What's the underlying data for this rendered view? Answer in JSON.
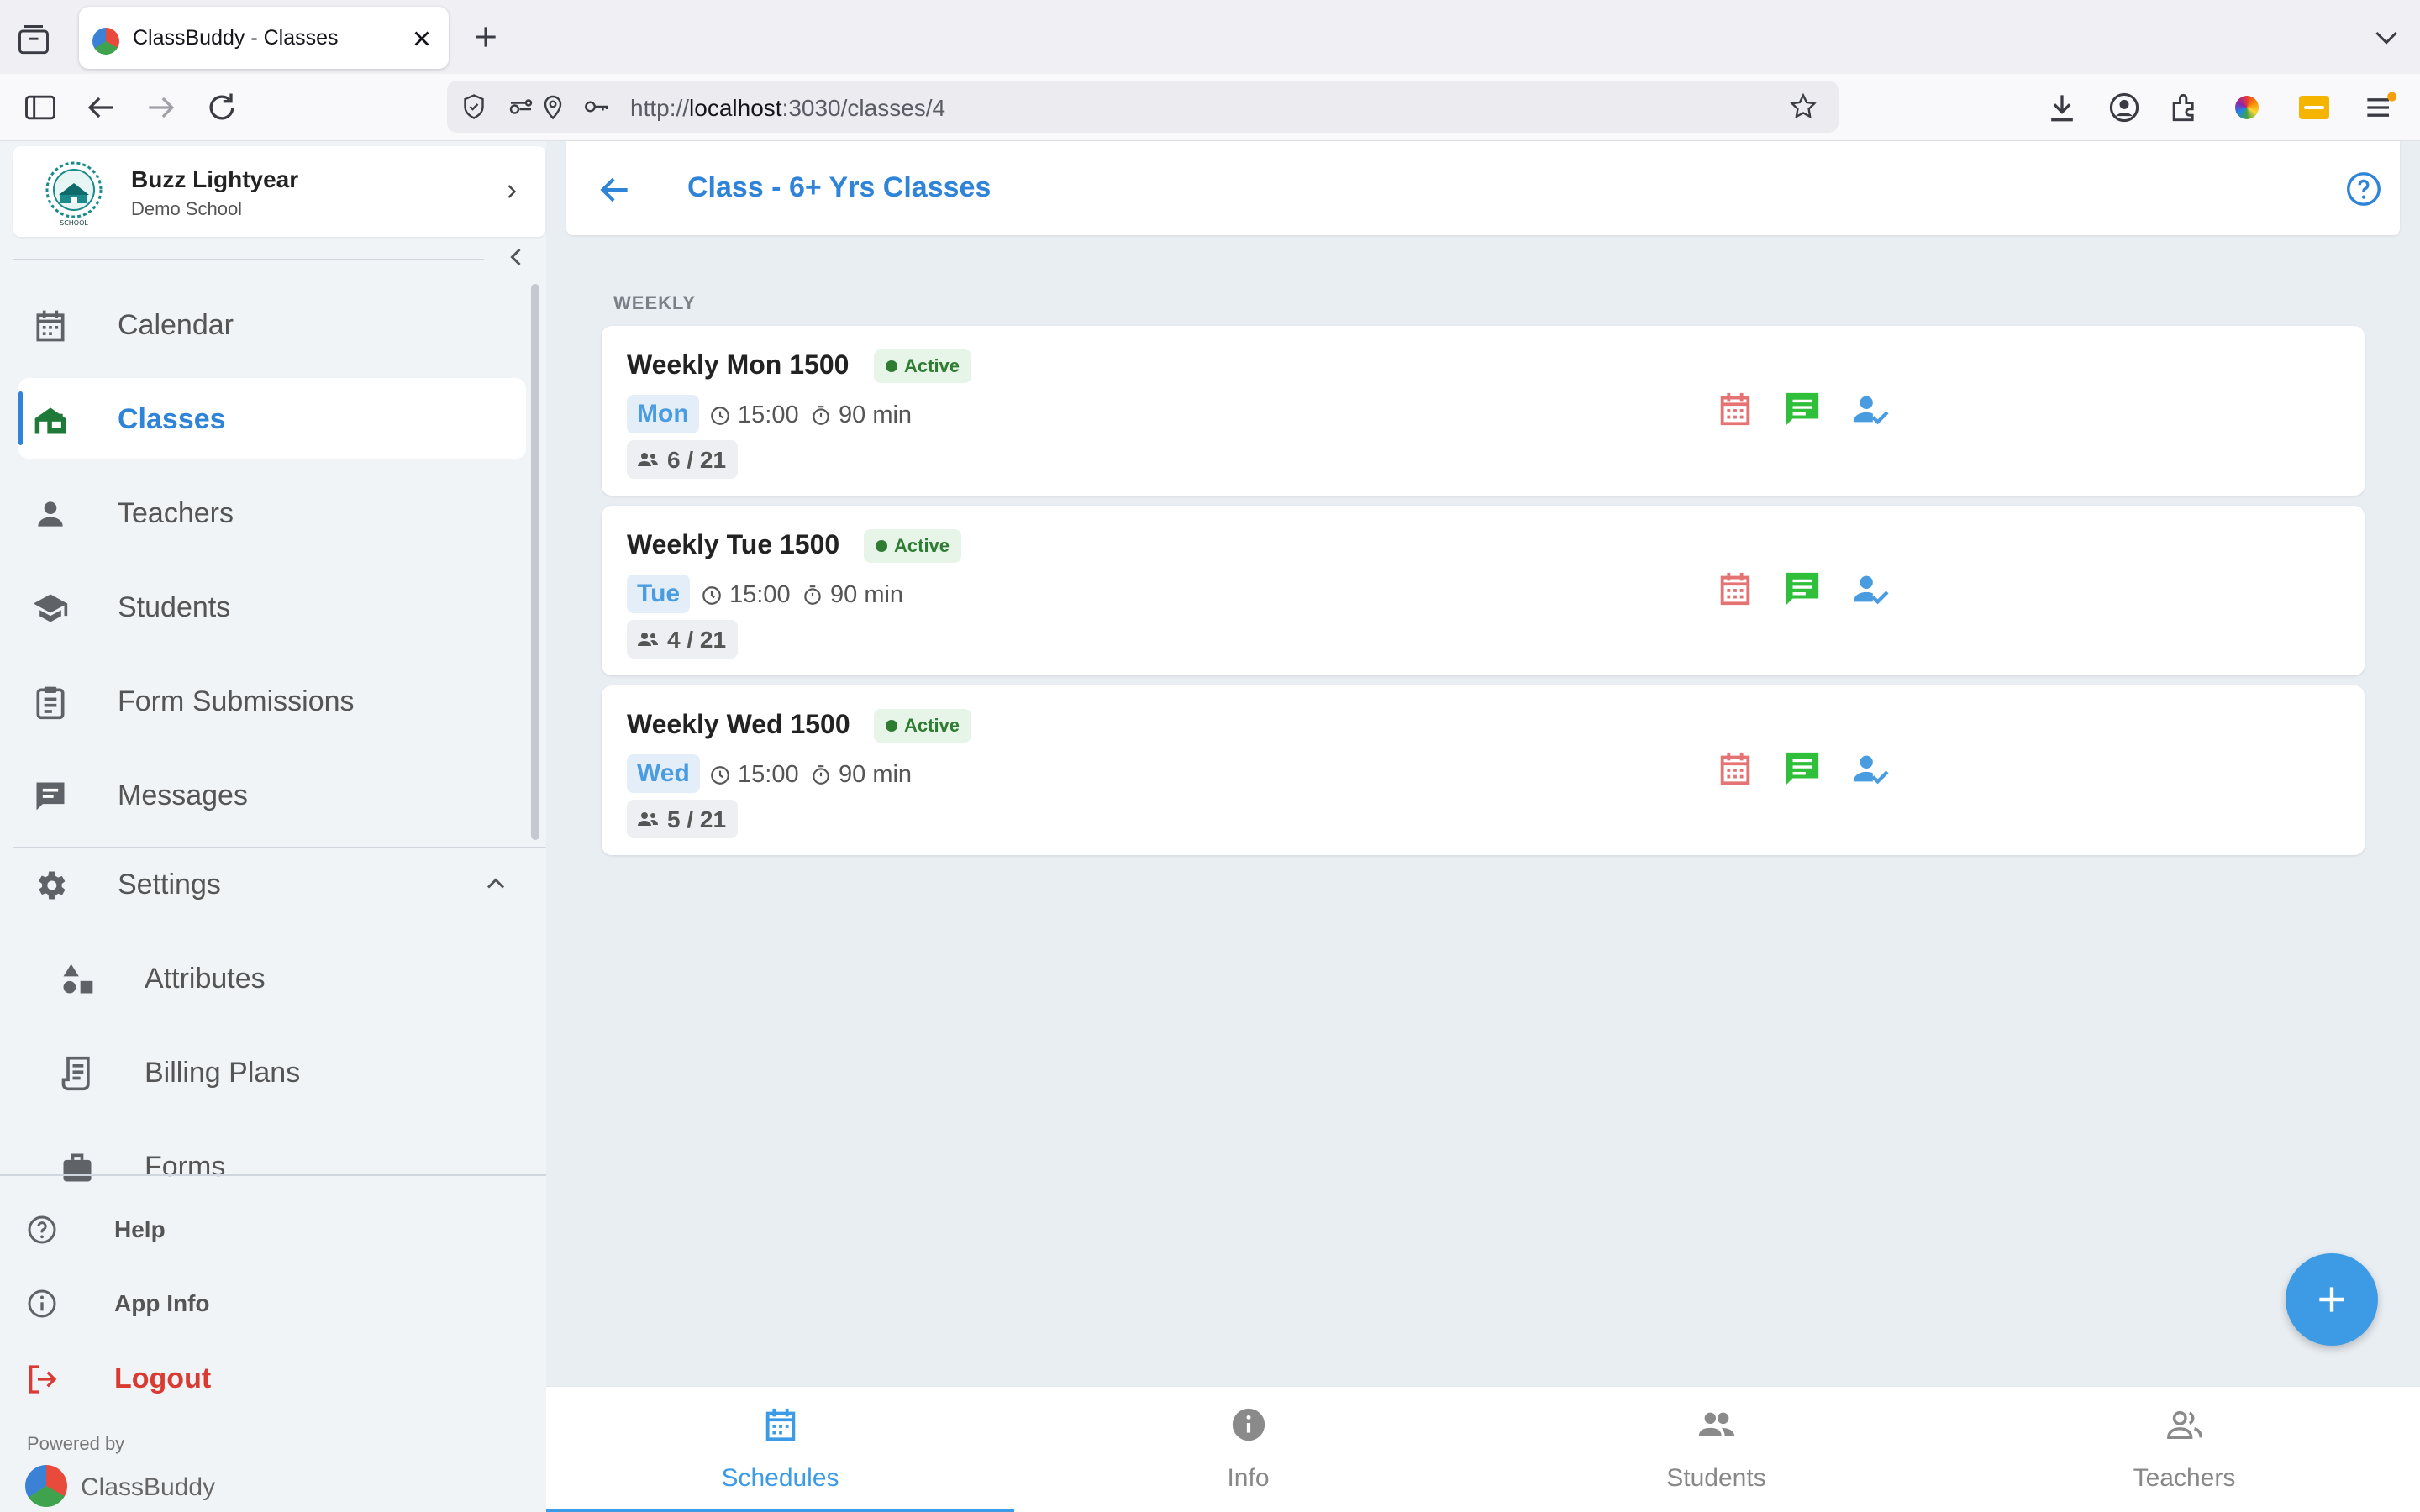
{
  "browser": {
    "tab_title": "ClassBuddy - Classes",
    "url_prefix": "http://",
    "url_host": "localhost",
    "url_rest": ":3030/classes/4"
  },
  "sidebar": {
    "profile": {
      "name": "Buzz Lightyear",
      "school": "Demo School"
    },
    "items": [
      {
        "label": "Calendar",
        "icon": "calendar-icon"
      },
      {
        "label": "Classes",
        "icon": "school-house-icon",
        "active": true
      },
      {
        "label": "Teachers",
        "icon": "person-icon"
      },
      {
        "label": "Students",
        "icon": "graduation-cap-icon"
      },
      {
        "label": "Form Submissions",
        "icon": "clipboard-icon"
      },
      {
        "label": "Messages",
        "icon": "message-icon"
      },
      {
        "label": "Settings",
        "icon": "gear-icon",
        "expanded": true
      }
    ],
    "settings_items": [
      {
        "label": "Attributes",
        "icon": "shapes-icon"
      },
      {
        "label": "Billing Plans",
        "icon": "receipt-icon"
      },
      {
        "label": "Forms",
        "icon": "briefcase-icon"
      }
    ],
    "footer": {
      "help": "Help",
      "app_info": "App Info",
      "logout": "Logout",
      "powered_by": "Powered by",
      "brand": "ClassBuddy"
    }
  },
  "header": {
    "title": "Class - 6+ Yrs Classes"
  },
  "section_label": "WEEKLY",
  "schedules": [
    {
      "title": "Weekly Mon 1500",
      "status": "Active",
      "day": "Mon",
      "time": "15:00",
      "duration": "90 min",
      "enrolled": "6 / 21"
    },
    {
      "title": "Weekly Tue 1500",
      "status": "Active",
      "day": "Tue",
      "time": "15:00",
      "duration": "90 min",
      "enrolled": "4 / 21"
    },
    {
      "title": "Weekly Wed 1500",
      "status": "Active",
      "day": "Wed",
      "time": "15:00",
      "duration": "90 min",
      "enrolled": "5 / 21"
    }
  ],
  "bottom_nav": {
    "items": [
      {
        "label": "Schedules",
        "icon": "calendar-icon",
        "active": true
      },
      {
        "label": "Info",
        "icon": "info-icon"
      },
      {
        "label": "Students",
        "icon": "group-icon"
      },
      {
        "label": "Teachers",
        "icon": "people-outline-icon"
      }
    ]
  },
  "colors": {
    "accent": "#2f84d8",
    "active_badge": "#2f7d32",
    "logout": "#d93a32",
    "calendar_action": "#e57373",
    "message_action": "#2fbf3a"
  }
}
